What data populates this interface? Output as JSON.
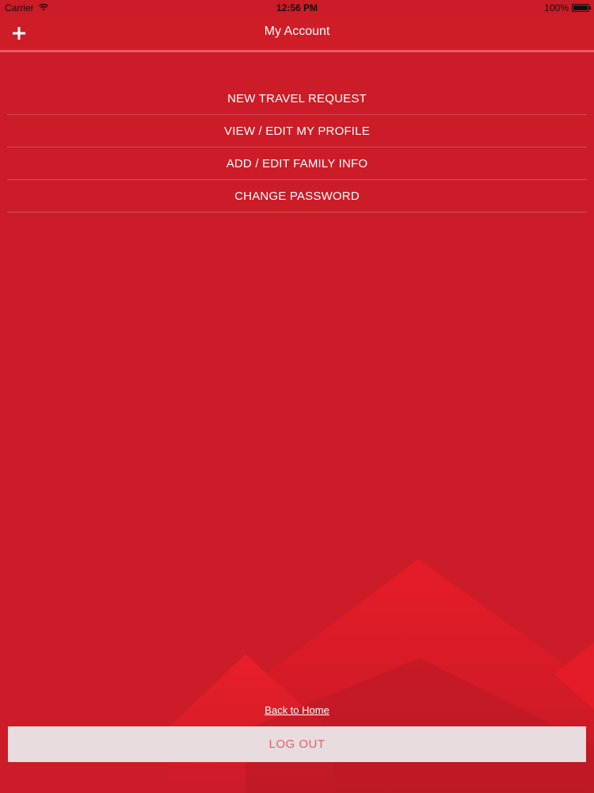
{
  "status_bar": {
    "carrier": "Carrier",
    "time": "12:56 PM",
    "battery": "100%",
    "wifi_icon": "wifi-icon",
    "battery_icon": "battery-icon"
  },
  "nav_bar": {
    "title": "My Account",
    "add_icon": "plus-icon"
  },
  "menu": {
    "items": [
      {
        "label": "NEW TRAVEL REQUEST"
      },
      {
        "label": "VIEW / EDIT MY PROFILE"
      },
      {
        "label": "ADD / EDIT FAMILY INFO"
      },
      {
        "label": "CHANGE PASSWORD"
      }
    ]
  },
  "footer": {
    "back_link": "Back to Home",
    "logout_label": "LOG OUT"
  },
  "colors": {
    "background": "#cc1c27",
    "nav_underline": "#ee5a66",
    "logout_bg": "#e8dcdf",
    "logout_text": "#e2606c"
  }
}
